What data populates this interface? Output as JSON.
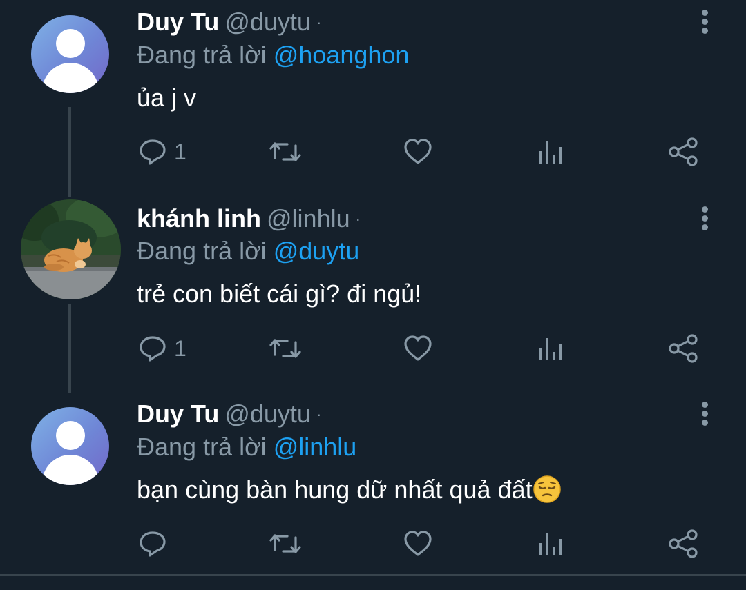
{
  "tweets": [
    {
      "display_name": "Duy Tu",
      "handle": "@duytu",
      "separator": "·",
      "reply_prefix": "Đang trả lời",
      "reply_to": "@hoanghon",
      "text": "ủa j v",
      "reply_count": "1",
      "avatar": "default-profile-icon"
    },
    {
      "display_name": "khánh linh",
      "handle": "@linhlu",
      "separator": "·",
      "reply_prefix": "Đang trả lời",
      "reply_to": "@duytu",
      "text": "trẻ con biết cái gì? đi ngủ!",
      "reply_count": "1",
      "avatar": "cat-photo"
    },
    {
      "display_name": "Duy Tu",
      "handle": "@duytu",
      "separator": "·",
      "reply_prefix": "Đang trả lời",
      "reply_to": "@linhlu",
      "text": "bạn cùng bàn hung dữ nhất quả đất",
      "text_emoji": "pensive-face-emoji",
      "reply_count": "",
      "avatar": "default-profile-icon"
    }
  ],
  "icons": {
    "reply": "reply-icon",
    "retweet": "retweet-icon",
    "like": "heart-icon",
    "analytics": "analytics-icon",
    "share": "share-icon",
    "more": "more-vertical-icon"
  },
  "colors": {
    "background": "#15202b",
    "secondary_text": "#8899a6",
    "link": "#1da1f2",
    "divider": "#38444d"
  }
}
